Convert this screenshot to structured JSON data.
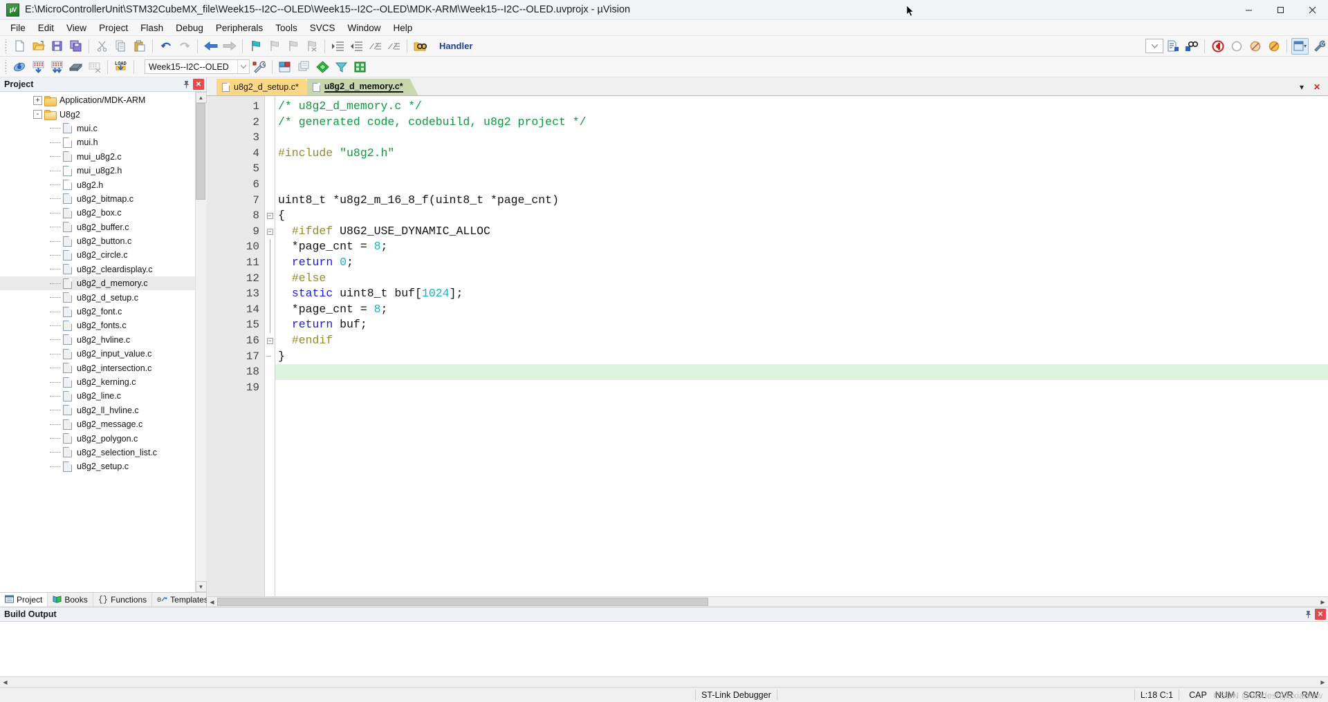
{
  "window": {
    "title": "E:\\MicroControllerUnit\\STM32CubeMX_file\\Week15--I2C--OLED\\Week15--I2C--OLED\\MDK-ARM\\Week15--I2C--OLED.uvprojx - µVision",
    "app_icon": "uvision-icon",
    "minimize": "–",
    "maximize": "▢",
    "close": "✕"
  },
  "menu": {
    "items": [
      {
        "label": "File"
      },
      {
        "label": "Edit"
      },
      {
        "label": "View"
      },
      {
        "label": "Project"
      },
      {
        "label": "Flash"
      },
      {
        "label": "Debug"
      },
      {
        "label": "Peripherals"
      },
      {
        "label": "Tools"
      },
      {
        "label": "SVCS"
      },
      {
        "label": "Window"
      },
      {
        "label": "Help"
      }
    ]
  },
  "toolbar_main": {
    "handler_label": "Handler",
    "buttons": [
      "new-file-icon",
      "open-file-icon",
      "save-icon",
      "save-all-icon",
      "cut-icon",
      "copy-icon",
      "paste-icon",
      "undo-icon",
      "redo-icon",
      "navigate-back-icon",
      "navigate-forward-icon",
      "bookmark-toggle-icon",
      "bookmark-prev-icon",
      "bookmark-next-icon",
      "bookmark-clear-icon",
      "indent-icon",
      "outdent-icon",
      "comment-icon",
      "uncomment-icon",
      "find-in-files-icon"
    ],
    "right_buttons": [
      "handler-dropdown-icon",
      "insert-file-icon",
      "browse-symbol-icon",
      "debug-stop-icon",
      "breakpoint-icon",
      "disable-breakpoint-icon",
      "kill-breakpoints-icon",
      "window-layout-icon",
      "configure-icon"
    ]
  },
  "toolbar_build": {
    "project_target": "Week15--I2C--OLED",
    "load_label": "LOAD",
    "buttons": [
      "translate-icon",
      "build-icon",
      "rebuild-icon",
      "batch-build-icon",
      "stop-build-icon",
      "download-icon"
    ],
    "right_buttons": [
      "target-options-icon",
      "manage-run-env-icon",
      "start-debug-icon",
      "print-icon"
    ],
    "after_combo_buttons": [
      "target-options-icon",
      "manage-project-items-icon",
      "pack-installer-icon",
      "filter-icon",
      "manage-run-env-icon"
    ]
  },
  "project_pane": {
    "title": "Project",
    "pin_icon": "pin-icon",
    "close_icon": "close-icon",
    "tree": [
      {
        "label": "Application/MDK-ARM",
        "type": "folder",
        "depth": 1,
        "expander": "+",
        "selected": false
      },
      {
        "label": "U8g2",
        "type": "folder-open",
        "depth": 1,
        "expander": "-",
        "selected": false
      },
      {
        "label": "mui.c",
        "type": "file-gray",
        "depth": 2,
        "selected": false
      },
      {
        "label": "mui.h",
        "type": "file",
        "depth": 2,
        "selected": false
      },
      {
        "label": "mui_u8g2.c",
        "type": "file-gray",
        "depth": 2,
        "selected": false
      },
      {
        "label": "mui_u8g2.h",
        "type": "file",
        "depth": 2,
        "selected": false
      },
      {
        "label": "u8g2.h",
        "type": "file",
        "depth": 2,
        "selected": false
      },
      {
        "label": "u8g2_bitmap.c",
        "type": "file-gray",
        "depth": 2,
        "selected": false
      },
      {
        "label": "u8g2_box.c",
        "type": "file-gray",
        "depth": 2,
        "selected": false
      },
      {
        "label": "u8g2_buffer.c",
        "type": "file-gray",
        "depth": 2,
        "selected": false
      },
      {
        "label": "u8g2_button.c",
        "type": "file-gray",
        "depth": 2,
        "selected": false
      },
      {
        "label": "u8g2_circle.c",
        "type": "file-gray",
        "depth": 2,
        "selected": false
      },
      {
        "label": "u8g2_cleardisplay.c",
        "type": "file-gray",
        "depth": 2,
        "selected": false
      },
      {
        "label": "u8g2_d_memory.c",
        "type": "file-gray",
        "depth": 2,
        "selected": true
      },
      {
        "label": "u8g2_d_setup.c",
        "type": "file-gray",
        "depth": 2,
        "selected": false
      },
      {
        "label": "u8g2_font.c",
        "type": "file-gray",
        "depth": 2,
        "selected": false
      },
      {
        "label": "u8g2_fonts.c",
        "type": "file-gray",
        "depth": 2,
        "selected": false
      },
      {
        "label": "u8g2_hvline.c",
        "type": "file-gray",
        "depth": 2,
        "selected": false
      },
      {
        "label": "u8g2_input_value.c",
        "type": "file-gray",
        "depth": 2,
        "selected": false
      },
      {
        "label": "u8g2_intersection.c",
        "type": "file-gray",
        "depth": 2,
        "selected": false
      },
      {
        "label": "u8g2_kerning.c",
        "type": "file-gray",
        "depth": 2,
        "selected": false
      },
      {
        "label": "u8g2_line.c",
        "type": "file-gray",
        "depth": 2,
        "selected": false
      },
      {
        "label": "u8g2_ll_hvline.c",
        "type": "file-gray",
        "depth": 2,
        "selected": false
      },
      {
        "label": "u8g2_message.c",
        "type": "file-gray",
        "depth": 2,
        "selected": false
      },
      {
        "label": "u8g2_polygon.c",
        "type": "file-gray",
        "depth": 2,
        "selected": false
      },
      {
        "label": "u8g2_selection_list.c",
        "type": "file-gray",
        "depth": 2,
        "selected": false
      },
      {
        "label": "u8g2_setup.c",
        "type": "file-gray",
        "depth": 2,
        "selected": false
      }
    ],
    "tabs": [
      {
        "label": "Project",
        "icon": "project-icon",
        "active": true
      },
      {
        "label": "Books",
        "icon": "books-icon",
        "active": false
      },
      {
        "label": "Functions",
        "icon": "functions-icon",
        "active": false
      },
      {
        "label": "Templates",
        "icon": "templates-icon",
        "active": false
      }
    ]
  },
  "editor": {
    "tabs": [
      {
        "label": "u8g2_d_setup.c*",
        "active": false,
        "color": "#fcd884"
      },
      {
        "label": "u8g2_d_memory.c*",
        "active": true,
        "color": "#c9d7ae"
      }
    ],
    "tab_controls": {
      "dropdown": "▾",
      "close": "✕"
    },
    "current_line": 18,
    "lines": [
      {
        "n": 1,
        "fold": "none",
        "tokens": [
          {
            "t": "/* u8g2_d_memory.c */",
            "c": "cmt"
          }
        ]
      },
      {
        "n": 2,
        "fold": "none",
        "tokens": [
          {
            "t": "/* generated code, codebuild, u8g2 project */",
            "c": "cmt"
          }
        ]
      },
      {
        "n": 3,
        "fold": "none",
        "tokens": []
      },
      {
        "n": 4,
        "fold": "none",
        "tokens": [
          {
            "t": "#include ",
            "c": "pre"
          },
          {
            "t": "\"u8g2.h\"",
            "c": "cmt"
          }
        ]
      },
      {
        "n": 5,
        "fold": "none",
        "tokens": []
      },
      {
        "n": 6,
        "fold": "none",
        "tokens": []
      },
      {
        "n": 7,
        "fold": "none",
        "tokens": [
          {
            "t": "uint8_t *u8g2_m_16_8_f(uint8_t *page_cnt)",
            "c": "txt"
          }
        ]
      },
      {
        "n": 8,
        "fold": "box",
        "tokens": [
          {
            "t": "{",
            "c": "txt"
          }
        ]
      },
      {
        "n": 9,
        "fold": "box",
        "tokens": [
          {
            "t": "  ",
            "c": "txt"
          },
          {
            "t": "#ifdef ",
            "c": "pre"
          },
          {
            "t": "U8G2_USE_DYNAMIC_ALLOC",
            "c": "txt"
          }
        ]
      },
      {
        "n": 10,
        "fold": "line",
        "tokens": [
          {
            "t": "  *page_cnt = ",
            "c": "txt"
          },
          {
            "t": "8",
            "c": "num"
          },
          {
            "t": ";",
            "c": "txt"
          }
        ]
      },
      {
        "n": 11,
        "fold": "line",
        "tokens": [
          {
            "t": "  ",
            "c": "txt"
          },
          {
            "t": "return ",
            "c": "kw"
          },
          {
            "t": "0",
            "c": "num"
          },
          {
            "t": ";",
            "c": "txt"
          }
        ]
      },
      {
        "n": 12,
        "fold": "line",
        "tokens": [
          {
            "t": "  ",
            "c": "txt"
          },
          {
            "t": "#else",
            "c": "pre"
          }
        ]
      },
      {
        "n": 13,
        "fold": "line",
        "tokens": [
          {
            "t": "  ",
            "c": "txt"
          },
          {
            "t": "static ",
            "c": "kw"
          },
          {
            "t": "uint8_t buf[",
            "c": "txt"
          },
          {
            "t": "1024",
            "c": "num"
          },
          {
            "t": "];",
            "c": "txt"
          }
        ]
      },
      {
        "n": 14,
        "fold": "line",
        "tokens": [
          {
            "t": "  *page_cnt = ",
            "c": "txt"
          },
          {
            "t": "8",
            "c": "num"
          },
          {
            "t": ";",
            "c": "txt"
          }
        ]
      },
      {
        "n": 15,
        "fold": "line",
        "tokens": [
          {
            "t": "  ",
            "c": "txt"
          },
          {
            "t": "return ",
            "c": "kw"
          },
          {
            "t": "buf;",
            "c": "txt"
          }
        ]
      },
      {
        "n": 16,
        "fold": "endbox",
        "tokens": [
          {
            "t": "  ",
            "c": "txt"
          },
          {
            "t": "#endif",
            "c": "pre"
          }
        ]
      },
      {
        "n": 17,
        "fold": "end",
        "tokens": [
          {
            "t": "}",
            "c": "txt"
          }
        ]
      },
      {
        "n": 18,
        "fold": "none",
        "tokens": []
      },
      {
        "n": 19,
        "fold": "none",
        "tokens": []
      }
    ]
  },
  "build_output": {
    "title": "Build Output",
    "pin_icon": "pin-icon",
    "close_icon": "close-icon",
    "content": ""
  },
  "status_bar": {
    "debugger": "ST-Link Debugger",
    "position": "L:18 C:1",
    "flags": [
      {
        "label": "CAP",
        "dim": false
      },
      {
        "label": "NUM",
        "dim": false
      },
      {
        "label": "SCRL",
        "dim": false
      },
      {
        "label": "OVR",
        "dim": false
      },
      {
        "label": "R/W",
        "dim": false
      }
    ],
    "watermark": "CSDN @wodeshijiexiaolaw"
  }
}
